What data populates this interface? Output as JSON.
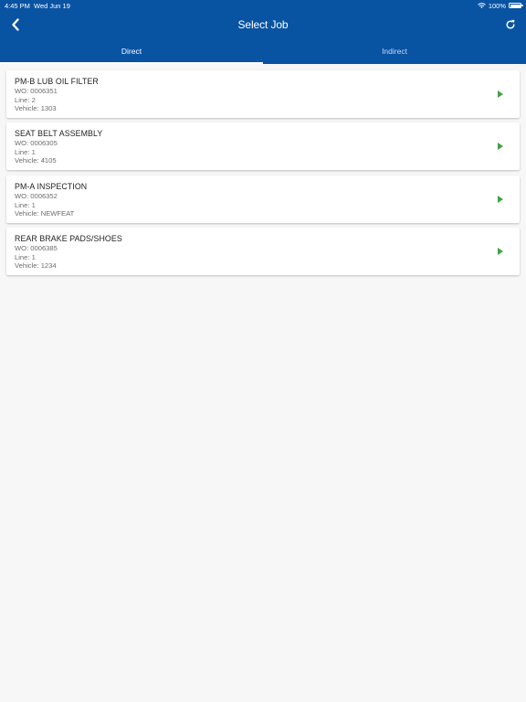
{
  "status_bar": {
    "time": "4:45 PM",
    "date": "Wed Jun 19",
    "battery": "100%"
  },
  "header": {
    "title": "Select Job",
    "back_icon": "chevron-left-icon",
    "refresh_icon": "refresh-icon",
    "color": "#0953a3"
  },
  "tabs": [
    {
      "label": "Direct",
      "active": true
    },
    {
      "label": "Indirect",
      "active": false
    }
  ],
  "jobs": [
    {
      "title": "PM-B LUB OIL FILTER",
      "wo": "WO: 0006351",
      "line": "Line: 2",
      "vehicle": "Vehicle: 1303"
    },
    {
      "title": "SEAT BELT ASSEMBLY",
      "wo": "WO: 0006305",
      "line": "Line: 1",
      "vehicle": "Vehicle: 4105"
    },
    {
      "title": "PM-A INSPECTION",
      "wo": "WO: 0006352",
      "line": "Line: 1",
      "vehicle": "Vehicle: NEWFEAT"
    },
    {
      "title": "REAR BRAKE PADS/SHOES",
      "wo": "WO: 0006385",
      "line": "Line: 1",
      "vehicle": "Vehicle: 1234"
    }
  ],
  "play_icon": "play-icon",
  "accent_green": "#43a047"
}
